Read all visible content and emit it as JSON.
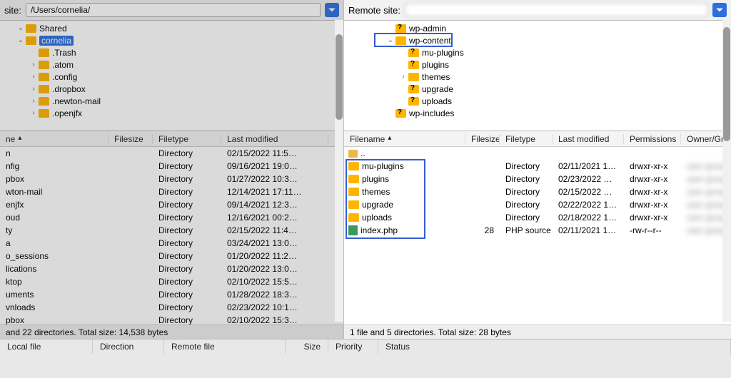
{
  "local": {
    "label": "site:",
    "path": "/Users/cornelia/",
    "tree": [
      {
        "indent": 2,
        "arrow": "open",
        "name": "Shared",
        "q": false
      },
      {
        "indent": 2,
        "arrow": "open",
        "name": "cornelia",
        "q": false,
        "selected": true
      },
      {
        "indent": 3,
        "arrow": "",
        "name": ".Trash",
        "q": false
      },
      {
        "indent": 3,
        "arrow": "closed",
        "name": ".atom",
        "q": false
      },
      {
        "indent": 3,
        "arrow": "closed",
        "name": ".config",
        "q": false
      },
      {
        "indent": 3,
        "arrow": "closed",
        "name": ".dropbox",
        "q": false
      },
      {
        "indent": 3,
        "arrow": "closed",
        "name": ".newton-mail",
        "q": false
      },
      {
        "indent": 3,
        "arrow": "closed",
        "name": ".openjfx",
        "q": false
      }
    ],
    "headers": {
      "name": "ne",
      "size": "Filesize",
      "type": "Filetype",
      "mod": "Last modified"
    },
    "rows": [
      {
        "name": "n",
        "type": "Directory",
        "mod": "02/15/2022 11:5…"
      },
      {
        "name": "nfig",
        "type": "Directory",
        "mod": "09/16/2021 19:0…"
      },
      {
        "name": "pbox",
        "type": "Directory",
        "mod": "01/27/2022 10:3…"
      },
      {
        "name": "wton-mail",
        "type": "Directory",
        "mod": "12/14/2021 17:11…"
      },
      {
        "name": "enjfx",
        "type": "Directory",
        "mod": "09/14/2021 12:3…"
      },
      {
        "name": "oud",
        "type": "Directory",
        "mod": "12/16/2021 00:2…"
      },
      {
        "name": "ty",
        "type": "Directory",
        "mod": "02/15/2022 11:4…"
      },
      {
        "name": "a",
        "type": "Directory",
        "mod": "03/24/2021 13:0…"
      },
      {
        "name": "o_sessions",
        "type": "Directory",
        "mod": "01/20/2022 11:2…"
      },
      {
        "name": "lications",
        "type": "Directory",
        "mod": "01/20/2022 13:0…"
      },
      {
        "name": "ktop",
        "type": "Directory",
        "mod": "02/10/2022 15:5…"
      },
      {
        "name": "uments",
        "type": "Directory",
        "mod": "01/28/2022 18:3…"
      },
      {
        "name": "vnloads",
        "type": "Directory",
        "mod": "02/23/2022 10:1…"
      },
      {
        "name": "pbox",
        "type": "Directory",
        "mod": "02/10/2022 15:3…"
      }
    ],
    "status": "and 22 directories. Total size: 14,538 bytes"
  },
  "remote": {
    "label": "Remote site:",
    "path": "                                   ",
    "tree": [
      {
        "indent": 3,
        "arrow": "",
        "name": "wp-admin",
        "q": true
      },
      {
        "indent": 3,
        "arrow": "open",
        "name": "wp-content",
        "q": false,
        "boxed": true
      },
      {
        "indent": 4,
        "arrow": "",
        "name": "mu-plugins",
        "q": true
      },
      {
        "indent": 4,
        "arrow": "",
        "name": "plugins",
        "q": true
      },
      {
        "indent": 4,
        "arrow": "closed",
        "name": "themes",
        "q": false
      },
      {
        "indent": 4,
        "arrow": "",
        "name": "upgrade",
        "q": true
      },
      {
        "indent": 4,
        "arrow": "",
        "name": "uploads",
        "q": true
      },
      {
        "indent": 3,
        "arrow": "",
        "name": "wp-includes",
        "q": true
      }
    ],
    "headers": {
      "name": "Filename",
      "size": "Filesize",
      "type": "Filetype",
      "mod": "Last modified",
      "perm": "Permissions",
      "own": "Owner/Group"
    },
    "rows": [
      {
        "icon": "parent",
        "name": "..",
        "size": "",
        "type": "",
        "mod": "",
        "perm": "",
        "own": ""
      },
      {
        "icon": "folder",
        "name": "mu-plugins",
        "size": "",
        "type": "Directory",
        "mod": "02/11/2021 1…",
        "perm": "drwxr-xr-x",
        "own": "user group"
      },
      {
        "icon": "folder",
        "name": "plugins",
        "size": "",
        "type": "Directory",
        "mod": "02/23/2022 …",
        "perm": "drwxr-xr-x",
        "own": "user group"
      },
      {
        "icon": "folder",
        "name": "themes",
        "size": "",
        "type": "Directory",
        "mod": "02/15/2022 …",
        "perm": "drwxr-xr-x",
        "own": "user group"
      },
      {
        "icon": "folder",
        "name": "upgrade",
        "size": "",
        "type": "Directory",
        "mod": "02/22/2022 1…",
        "perm": "drwxr-xr-x",
        "own": "user group"
      },
      {
        "icon": "folder",
        "name": "uploads",
        "size": "",
        "type": "Directory",
        "mod": "02/18/2022 1…",
        "perm": "drwxr-xr-x",
        "own": "user group"
      },
      {
        "icon": "php",
        "name": "index.php",
        "size": "28",
        "type": "PHP source",
        "mod": "02/11/2021 1…",
        "perm": "-rw-r--r--",
        "own": "user group"
      }
    ],
    "status": "1 file and 5 directories. Total size: 28 bytes"
  },
  "queue": {
    "local": "Local file",
    "dir": "Direction",
    "remote": "Remote file",
    "size": "Size",
    "prio": "Priority",
    "stat": "Status"
  }
}
